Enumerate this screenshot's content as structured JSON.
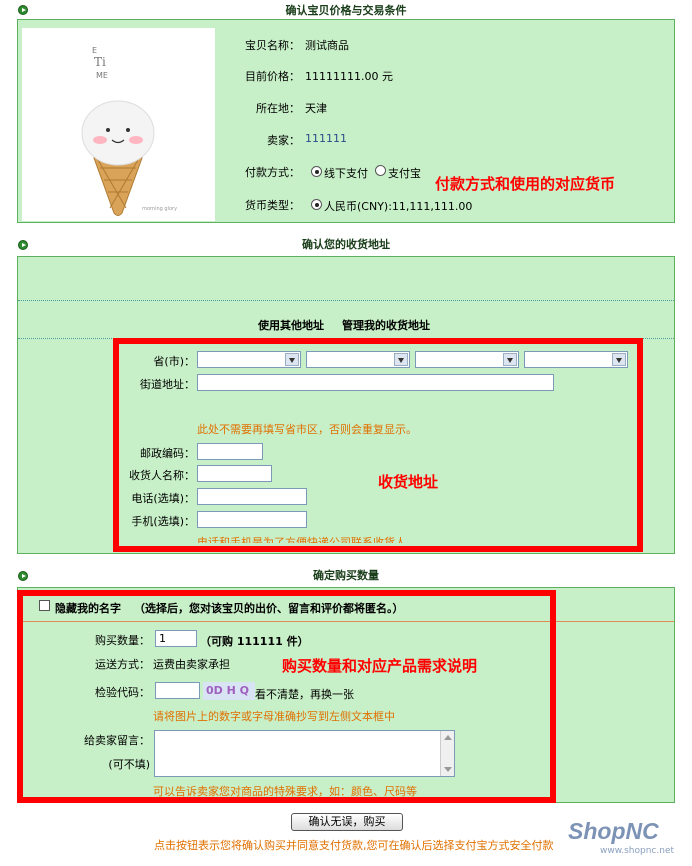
{
  "section1": {
    "title": "确认宝贝价格与交易条件",
    "item_name_label": "宝贝名称：",
    "item_name": "测试商品",
    "price_label": "目前价格：",
    "price": "11111111.00 元",
    "location_label": "所在地：",
    "location": "天津",
    "seller_label": "卖家：",
    "seller": "111111",
    "payment_label": "付款方式：",
    "payment_options": [
      "线下支付",
      "支付宝"
    ],
    "payment_selected": "线下支付",
    "currency_label": "货币类型：",
    "currency": "人民币(CNY):11,111,111.00",
    "annotation": "付款方式和使用的对应货币",
    "image_text": "Ti ME",
    "image_caption": "morning glory"
  },
  "section2": {
    "title": "确认您的收货地址",
    "link_other": "使用其他地址",
    "link_manage": "管理我的收货地址",
    "province_label": "省(市)：",
    "street_label": "街道地址：",
    "street_hint": "此处不需要再填写省市区，否则会重复显示。",
    "zip_label": "邮政编码：",
    "receiver_label": "收货人名称：",
    "phone_label": "电话(选填)：",
    "mobile_label": "手机(选填)：",
    "phone_hint": "电话和手机是为了方便快递公司联系收货人。",
    "annotation": "收货地址"
  },
  "section3": {
    "title": "确定购买数量",
    "anon_label": "隐藏我的名字",
    "anon_hint": "（选择后，您对该宝贝的出价、留言和评价都将匿名。）",
    "qty_label": "购买数量：",
    "qty_value": "1",
    "qty_available": "（可购 111111 件）",
    "ship_label": "运送方式：",
    "ship_value": "运费由卖家承担",
    "captcha_label": "检验代码：",
    "captcha_image_text": "0D H Q",
    "captcha_refresh": "看不清楚，再换一张",
    "captcha_hint": "请将图片上的数字或字母准确抄写到左侧文本框中",
    "message_label": "给卖家留言：",
    "message_optional": "(可不填)",
    "message_hint": "可以告诉卖家您对商品的特殊要求，如：颜色、尺码等",
    "annotation": "购买数量和对应产品需求说明"
  },
  "footer": {
    "confirm_button": "确认无误，购买",
    "note": "点击按钮表示您将确认购买并同意支付货款,您可在确认后选择支付宝方式安全付款",
    "logo": "ShopNC",
    "logo_url": "www.shopnc.net"
  }
}
